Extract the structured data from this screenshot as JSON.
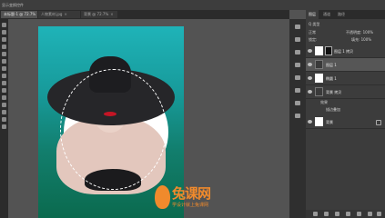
{
  "options_bar": {
    "label": "显示变换控件"
  },
  "tabs": [
    {
      "label": "未标题-1 @ 72.7%",
      "active": true
    },
    {
      "label": "人物素材.jpg",
      "active": false
    },
    {
      "label": "背景 @ 72.7%",
      "active": false
    }
  ],
  "canvas": {
    "watermark": {
      "brand": "兔课网",
      "subtitle": "学设计就上兔课网"
    }
  },
  "layers_panel": {
    "tabs": [
      "图层",
      "通道",
      "路径"
    ],
    "kind_label": "Q 类型",
    "blend_mode": "正常",
    "opacity_label": "不透明度: 100%",
    "lock_label": "锁定:",
    "fill_label": "填充: 100%",
    "layers": [
      {
        "name": "图层 1 拷贝",
        "thumb": "white",
        "selected": false,
        "mask": true
      },
      {
        "name": "图层 1",
        "thumb": "dark",
        "selected": true,
        "mask": false
      },
      {
        "name": "椭圆 1",
        "thumb": "white",
        "selected": false,
        "mask": false
      },
      {
        "name": "背景 拷贝",
        "thumb": "dark",
        "selected": false,
        "mask": false,
        "sublayers": [
          "效果",
          "描边叠加"
        ]
      },
      {
        "name": "背景",
        "thumb": "white",
        "selected": false,
        "mask": false,
        "locked": true
      }
    ]
  },
  "colors": {
    "bg": "#535353",
    "canvas_top": "#1fb3b8",
    "canvas_bottom": "#0b6a4e",
    "accent": "#f08a2c"
  }
}
